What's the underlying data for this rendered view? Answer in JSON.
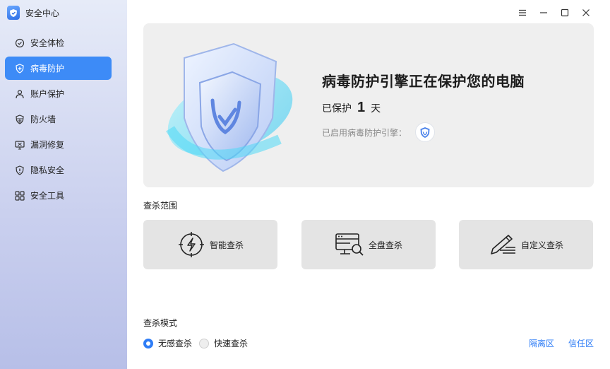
{
  "app": {
    "title": "安全中心"
  },
  "sidebar": {
    "items": [
      {
        "label": "安全体检",
        "icon": "check-circle-icon",
        "active": false
      },
      {
        "label": "病毒防护",
        "icon": "shield-plus-icon",
        "active": true
      },
      {
        "label": "账户保护",
        "icon": "user-icon",
        "active": false
      },
      {
        "label": "防火墙",
        "icon": "firewall-icon",
        "active": false
      },
      {
        "label": "漏洞修复",
        "icon": "monitor-fix-icon",
        "active": false
      },
      {
        "label": "隐私安全",
        "icon": "privacy-shield-icon",
        "active": false
      },
      {
        "label": "安全工具",
        "icon": "grid-tools-icon",
        "active": false
      }
    ]
  },
  "titlebar": {
    "buttons": [
      "menu-icon",
      "minimize-icon",
      "maximize-icon",
      "close-icon"
    ]
  },
  "hero": {
    "title": "病毒防护引擎正在保护您的电脑",
    "days_prefix": "已保护",
    "days_value": "1",
    "days_suffix": "天",
    "engine_label": "已启用病毒防护引擎："
  },
  "scan": {
    "section_label": "查杀范围",
    "options": [
      {
        "label": "智能查杀",
        "icon": "smart-scan-icon"
      },
      {
        "label": "全盘查杀",
        "icon": "full-scan-icon"
      },
      {
        "label": "自定义查杀",
        "icon": "custom-scan-icon"
      }
    ]
  },
  "mode": {
    "section_label": "查杀模式",
    "options": [
      {
        "label": "无感查杀",
        "selected": true
      },
      {
        "label": "快速查杀",
        "selected": false
      }
    ]
  },
  "links": {
    "quarantine": "隔离区",
    "trust": "信任区"
  },
  "colors": {
    "accent": "#3d8bf7",
    "link": "#2f7df6",
    "card": "#e4e4e4",
    "hero_bg": "#efefef"
  }
}
